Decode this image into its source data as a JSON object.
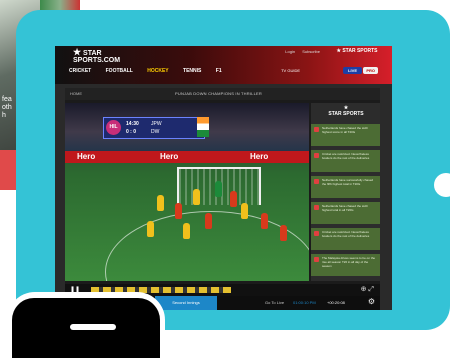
{
  "background": {
    "caption_lines": [
      "fea",
      "oth",
      "h"
    ]
  },
  "site": {
    "logo_line1": "STAR",
    "logo_line2": "SPORTS",
    "logo_suffix": ".COM",
    "top_links": [
      "Login",
      "Subscribe"
    ],
    "nav": [
      "CRICKET",
      "FOOTBALL",
      "HOCKEY",
      "TENNIS",
      "F1"
    ],
    "active_nav": "HOCKEY",
    "brand_right": "STAR SPORTS",
    "tv_guide": "TV GUIDE",
    "live_label": "LIVE",
    "pro_label": "PRO"
  },
  "breadcrumb": {
    "home": "HOME",
    "title": "PUNJAB DOWN CHAMPIONS IN THRILLER"
  },
  "scorebug": {
    "logo": "HIL",
    "team1": "14:30",
    "team2": "0 : 0",
    "score1": "JPW",
    "score2": "DW"
  },
  "ad_board": [
    "Hero",
    "Hero",
    "Hero"
  ],
  "sidebar": {
    "logo": "STAR SPORTS",
    "updates": [
      "Netherlands have chased the sixth highest score in all T20Is",
      "Cricket are restricted. Nevertheless bowlers do the rest of the deliveries",
      "Netherlands have successfully chased the fifth highest total in T20Is",
      "Netherlands have chased the sixth highest total in all T20Is",
      "Cricket are restricted. Nevertheless bowlers do the rest of the deliveries",
      "The Malaysia drives seems to be on the rise all season T20 in all day of the season"
    ]
  },
  "controls": {
    "pause": "❚❚",
    "zoom": "⊕",
    "fullscreen": "⤢"
  },
  "bottombar": {
    "live_label": "Second Innings",
    "go_live": "Go To Live",
    "time_label": "01:00:10 PM",
    "clock": "+00:20:08",
    "gear": "⚙"
  }
}
